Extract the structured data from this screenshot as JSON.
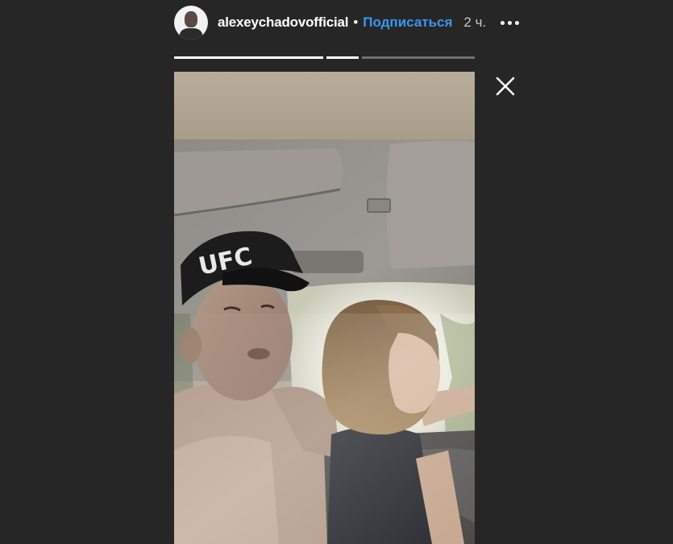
{
  "header": {
    "username": "alexeychadovofficial",
    "separator": "•",
    "follow_label": "Подписаться",
    "time": "2 ч.",
    "avatar_icon": "user-avatar-icon",
    "more_icon": "more-options-icon"
  },
  "progress": {
    "segments": [
      {
        "progress": 1.0
      },
      {
        "progress": 1.0
      },
      {
        "progress": 0.0
      }
    ]
  },
  "story": {
    "media_type": "video",
    "cap_text": "UFC"
  },
  "controls": {
    "close_icon": "close-icon"
  },
  "colors": {
    "background": "#262626",
    "accent": "#3897f0",
    "text": "#ffffff"
  }
}
